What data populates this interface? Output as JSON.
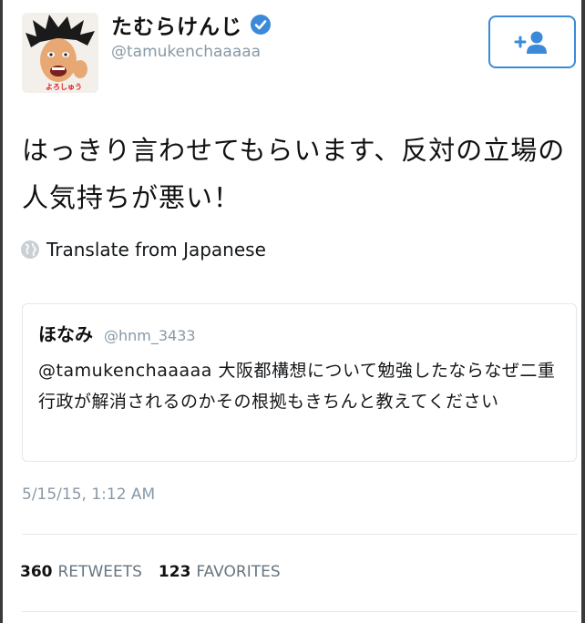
{
  "user": {
    "display_name": "たむらけんじ",
    "handle": "@tamukenchaaaaa",
    "avatar_caption": "よろしゅう"
  },
  "icons": {
    "verified": "verified-badge-icon",
    "follow": "add-user-icon",
    "translate": "globe-icon"
  },
  "tweet": {
    "text": "はっきり言わせてもらいます、反対の立場の人気持ちが悪い！",
    "translate_label": "Translate from Japanese",
    "timestamp": "5/15/15, 1:12 AM"
  },
  "quoted": {
    "name": "ほなみ",
    "handle": "@hnm_3433",
    "text": "@tamukenchaaaaa 大阪都構想について勉強したならなぜ二重行政が解消されるのかその根拠もきちんと教えてください"
  },
  "stats": {
    "retweets_count": "360",
    "retweets_label": "RETWEETS",
    "favorites_count": "123",
    "favorites_label": "FAVORITES"
  },
  "colors": {
    "accent": "#3b8ad9",
    "muted": "#8899a6",
    "border": "#e1e8ed"
  }
}
